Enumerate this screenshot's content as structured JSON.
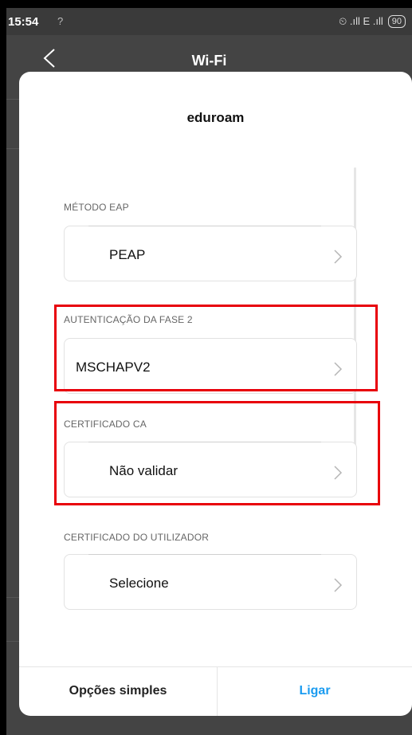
{
  "statusbar": {
    "time": "15:54",
    "wifi_glyph": "?",
    "signal_text": "⏲ .ıll E .ıll",
    "battery": "90"
  },
  "appbar": {
    "title": "Wi-Fi"
  },
  "dialog": {
    "title": "eduroam",
    "sections": [
      {
        "label": "MÉTODO EAP",
        "value": "PEAP"
      },
      {
        "label": "AUTENTICAÇÃO DA FASE 2",
        "value": "MSCHAPV2"
      },
      {
        "label": "CERTIFICADO CA",
        "value": "Não validar"
      },
      {
        "label": "CERTIFICADO DO UTILIZADOR",
        "value": "Selecione"
      }
    ],
    "buttons": {
      "simple": "Opções simples",
      "connect": "Ligar"
    }
  },
  "colors": {
    "accent": "#1a9bf0",
    "highlight": "#e8000b"
  }
}
